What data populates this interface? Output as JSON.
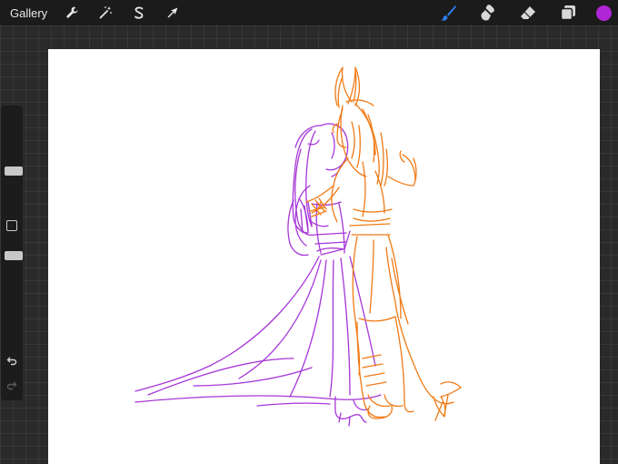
{
  "topbar": {
    "gallery_label": "Gallery",
    "left_tools": [
      "wrench-icon",
      "magic-wand-icon",
      "selection-icon",
      "transform-arrow-icon"
    ],
    "right_tools": [
      "brush-icon",
      "smudge-icon",
      "eraser-icon",
      "layers-icon"
    ]
  },
  "colors": {
    "active_color": "#b026d6",
    "brush_active": "#2f7ff0",
    "purple_sketch": "#a636d8",
    "orange_sketch": "#f07a16"
  },
  "sidebar": {
    "brush_size_level": 0.35,
    "opacity_level": 0.85
  }
}
